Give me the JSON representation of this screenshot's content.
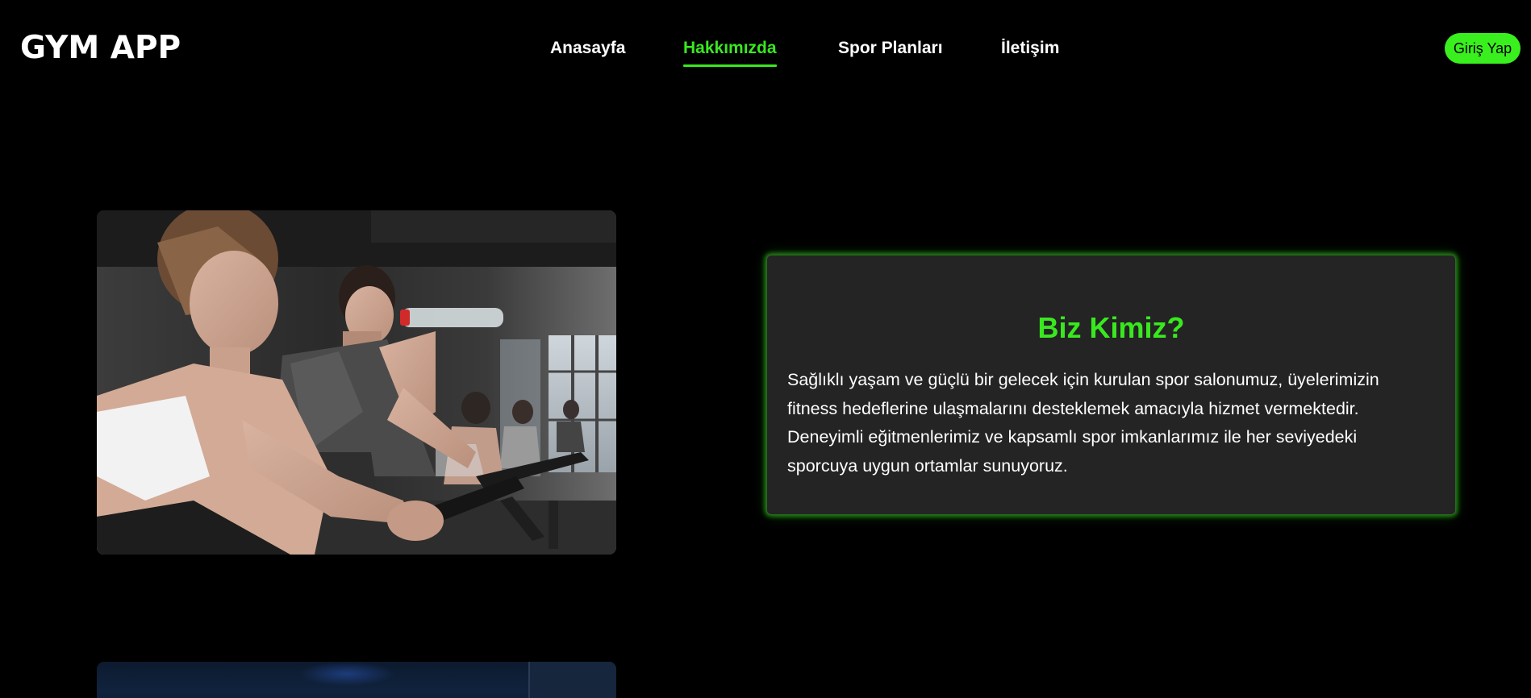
{
  "brand": {
    "logo_text": "GYM APP"
  },
  "nav": {
    "items": [
      {
        "label": "Anasayfa"
      },
      {
        "label": "Hakkımızda",
        "active": true
      },
      {
        "label": "Spor Planları"
      },
      {
        "label": "İletişim"
      }
    ],
    "login_label": "Giriş Yap"
  },
  "about": {
    "title": "Biz Kimiz?",
    "text": "Sağlıklı yaşam ve güçlü bir gelecek için kurulan spor salonumuz, üyelerimizin fitness hedeflerine ulaşmalarını desteklemek amacıyla hizmet vermektedir. Deneyimli eğitmenlerimiz ve kapsamlı spor imkanlarımız ile her seviyedeki sporcuya uygun ortamlar sunuyoruz.",
    "image_subject": "indoor-cycling-class-photo"
  },
  "colors": {
    "background": "#000000",
    "accent": "#39e81f",
    "card": "#242424",
    "text": "#ffffff"
  }
}
